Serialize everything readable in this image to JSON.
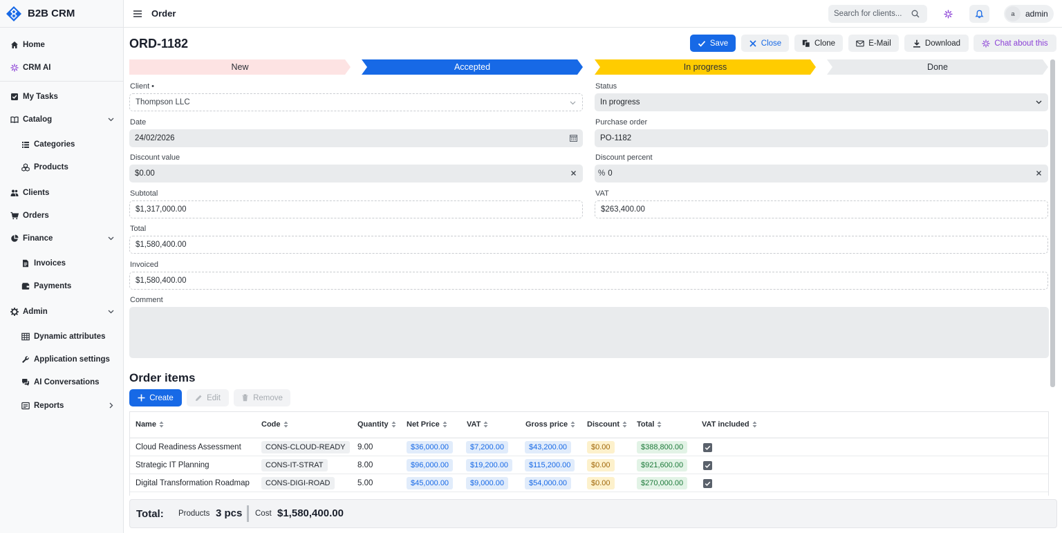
{
  "brand": {
    "name": "B2B CRM",
    "colors": {
      "primary": "#1769e6",
      "accent_purple": "#8a3fd6"
    }
  },
  "sidebar": {
    "items": [
      {
        "label": "Home",
        "icon": "home-icon"
      },
      {
        "label": "CRM AI",
        "icon": "sparkle-icon"
      },
      {
        "label": "My Tasks",
        "icon": "checkbox-icon"
      },
      {
        "label": "Catalog",
        "icon": "book-icon"
      },
      {
        "label": "Categories",
        "icon": "list-icon"
      },
      {
        "label": "Products",
        "icon": "cubes-icon"
      },
      {
        "label": "Clients",
        "icon": "users-icon"
      },
      {
        "label": "Orders",
        "icon": "cart-icon"
      },
      {
        "label": "Finance",
        "icon": "pie-chart-icon"
      },
      {
        "label": "Invoices",
        "icon": "file-icon"
      },
      {
        "label": "Payments",
        "icon": "wallet-icon"
      },
      {
        "label": "Admin",
        "icon": "gear-icon"
      },
      {
        "label": "Dynamic attributes",
        "icon": "table-icon"
      },
      {
        "label": "Application settings",
        "icon": "wrench-icon"
      },
      {
        "label": "AI Conversations",
        "icon": "chat-icon"
      },
      {
        "label": "Reports",
        "icon": "report-icon"
      }
    ]
  },
  "topbar": {
    "title": "Order",
    "search_placeholder": "Search for clients...",
    "user_initial": "a",
    "user_name": "admin"
  },
  "page": {
    "title": "ORD-1182",
    "actions": {
      "save": "Save",
      "close": "Close",
      "clone": "Clone",
      "email": "E-Mail",
      "download": "Download",
      "chat": "Chat about this"
    }
  },
  "stepper": {
    "steps": [
      {
        "label": "New",
        "bg": "#fde3e3",
        "fg": "#2a2f36"
      },
      {
        "label": "Accepted",
        "bg": "#1769e6",
        "fg": "#ffffff"
      },
      {
        "label": "In progress",
        "bg": "#ffcc00",
        "fg": "#2a2f36"
      },
      {
        "label": "Done",
        "bg": "#e9ebed",
        "fg": "#2a2f36"
      }
    ]
  },
  "form": {
    "client": {
      "label": "Client •",
      "value": "Thompson LLC"
    },
    "status": {
      "label": "Status",
      "value": "In progress"
    },
    "date": {
      "label": "Date",
      "value": "24/02/2026"
    },
    "purchase_order": {
      "label": "Purchase order",
      "value": "PO-1182"
    },
    "discount_value": {
      "label": "Discount value",
      "value": "$0.00"
    },
    "discount_percent": {
      "label": "Discount percent",
      "prefix": "%",
      "value": "0"
    },
    "subtotal": {
      "label": "Subtotal",
      "value": "$1,317,000.00"
    },
    "vat": {
      "label": "VAT",
      "value": "$263,400.00"
    },
    "total": {
      "label": "Total",
      "value": "$1,580,400.00"
    },
    "invoiced": {
      "label": "Invoiced",
      "value": "$1,580,400.00"
    },
    "comment": {
      "label": "Comment",
      "value": ""
    }
  },
  "order_items": {
    "title": "Order items",
    "buttons": {
      "create": "Create",
      "edit": "Edit",
      "remove": "Remove"
    },
    "columns": [
      "Name",
      "Code",
      "Quantity",
      "Net Price",
      "VAT",
      "Gross price",
      "Discount",
      "Total",
      "VAT included"
    ],
    "rows": [
      {
        "name": "Cloud Readiness Assessment",
        "code": "CONS-CLOUD-READY",
        "quantity": "9.00",
        "net_price": "$36,000.00",
        "vat": "$7,200.00",
        "gross_price": "$43,200.00",
        "discount": "$0.00",
        "total": "$388,800.00",
        "vat_included": true
      },
      {
        "name": "Strategic IT Planning",
        "code": "CONS-IT-STRAT",
        "quantity": "8.00",
        "net_price": "$96,000.00",
        "vat": "$19,200.00",
        "gross_price": "$115,200.00",
        "discount": "$0.00",
        "total": "$921,600.00",
        "vat_included": true
      },
      {
        "name": "Digital Transformation Roadmap",
        "code": "CONS-DIGI-ROAD",
        "quantity": "5.00",
        "net_price": "$45,000.00",
        "vat": "$9,000.00",
        "gross_price": "$54,000.00",
        "discount": "$0.00",
        "total": "$270,000.00",
        "vat_included": true
      }
    ]
  },
  "footer": {
    "total_label": "Total:",
    "products_label": "Products",
    "products_value": "3 pcs",
    "cost_label": "Cost",
    "cost_value": "$1,580,400.00"
  }
}
